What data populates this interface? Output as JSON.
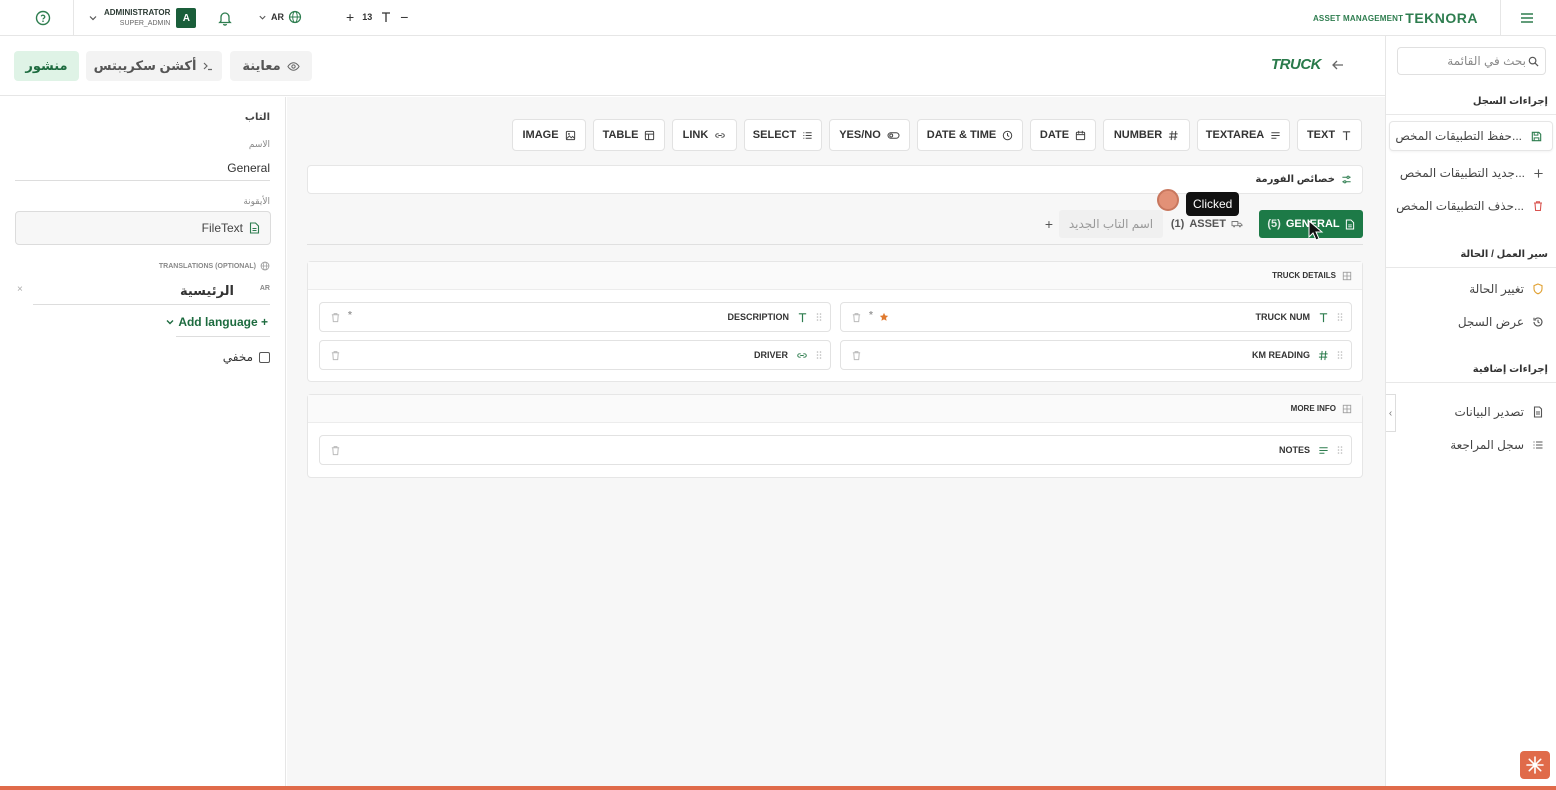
{
  "topbar": {
    "user_name": "ADMINISTRATOR",
    "user_role": "SUPER_ADMIN",
    "avatar_letter": "A",
    "lang": "AR",
    "font_size": "13",
    "brand_sub": "ASSET MANAGEMENT",
    "brand_logo": "TEKNORA"
  },
  "header": {
    "publish_label": "منشور",
    "scripts_label": "أكشن سكريبتس",
    "preview_label": "معاينة",
    "title": "TRUCK"
  },
  "sidebar": {
    "search_placeholder": "بحث في القائمة",
    "record_actions_title": "إجراءات السجل",
    "record_actions": [
      {
        "label": "حفظ التطبيقات المخص...",
        "icon": "save-icon"
      },
      {
        "label": "جديد التطبيقات المخص...",
        "icon": "plus-icon"
      },
      {
        "label": "حذف التطبيقات المخص...",
        "icon": "trash-icon"
      }
    ],
    "workflow_title": "سير العمل / الحالة",
    "workflow_items": [
      {
        "label": "تغيير الحالة",
        "icon": "shield-icon"
      },
      {
        "label": "عرض السجل",
        "icon": "history-icon"
      }
    ],
    "extra_title": "إجراءات إضافية",
    "extra_items": [
      {
        "label": "تصدير البيانات",
        "icon": "file-icon"
      },
      {
        "label": "سجل المراجعة",
        "icon": "list-icon"
      }
    ]
  },
  "left_panel": {
    "title": "التاب",
    "name_label": "الاسم",
    "name_value": "General",
    "icon_label": "الأيقونة",
    "icon_value": "FileText",
    "translations_label": "TRANSLATIONS (OPTIONAL)",
    "translation_code": "AR",
    "translation_value": "الرئيسية",
    "add_language": "Add language +",
    "hidden_label": "مخفي"
  },
  "field_types": [
    {
      "label": "TEXT",
      "icon": "text-icon"
    },
    {
      "label": "TEXTAREA",
      "icon": "textarea-icon"
    },
    {
      "label": "NUMBER",
      "icon": "hash-icon"
    },
    {
      "label": "DATE",
      "icon": "calendar-icon"
    },
    {
      "label": "DATE & TIME",
      "icon": "clock-icon"
    },
    {
      "label": "YES/NO",
      "icon": "toggle-icon"
    },
    {
      "label": "SELECT",
      "icon": "list-icon"
    },
    {
      "label": "LINK",
      "icon": "link-icon"
    },
    {
      "label": "TABLE",
      "icon": "table-icon"
    },
    {
      "label": "IMAGE",
      "icon": "image-icon"
    }
  ],
  "form_props_label": "خصائص الفورمة",
  "tabs": {
    "general_label": "GENERAL",
    "general_count": "(5)",
    "asset_label": "ASSET",
    "asset_count": "(1)",
    "new_tab_placeholder": "اسم التاب الجديد",
    "add": "+"
  },
  "sections": [
    {
      "title": "TRUCK DETAILS",
      "fields": [
        {
          "label": "TRUCK NUM",
          "type": "text",
          "required": "*"
        },
        {
          "label": "DESCRIPTION",
          "type": "text",
          "required": "*"
        },
        {
          "label": "KM READING",
          "type": "number"
        },
        {
          "label": "DRIVER",
          "type": "link"
        }
      ]
    },
    {
      "title": "MORE INFO",
      "fields": [
        {
          "label": "NOTES",
          "type": "textarea"
        }
      ]
    }
  ],
  "overlay": {
    "tooltip": "Clicked"
  },
  "colors": {
    "brand_green": "#1d7a47",
    "accent_orange": "#e06b4a"
  }
}
